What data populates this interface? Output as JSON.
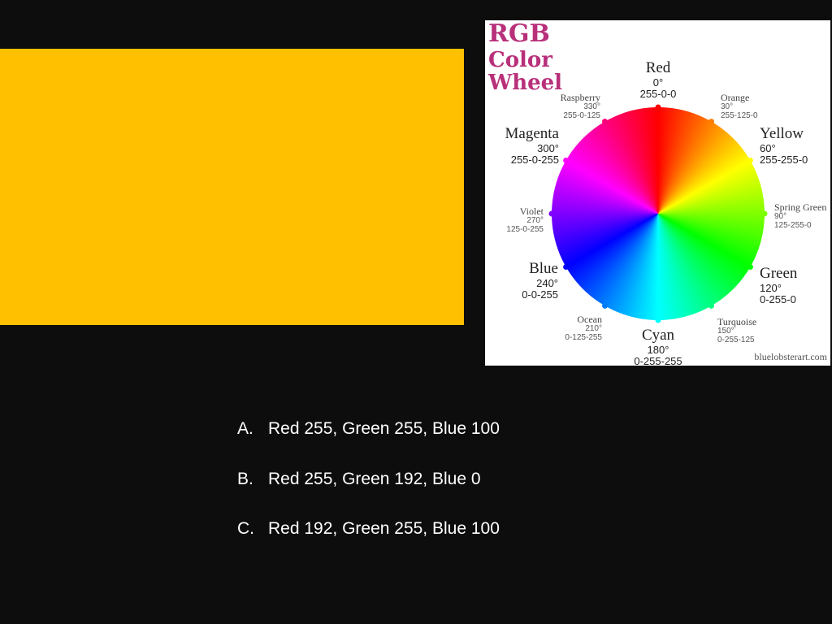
{
  "swatch": {
    "color": "#FFC000"
  },
  "wheel": {
    "title_lines": [
      "RGB",
      "Color",
      "Wheel"
    ],
    "title_color": "#B8307A",
    "credit": "bluelobsterart.com",
    "hues": [
      {
        "name": "Red",
        "deg": "0°",
        "rgb": "255-0-0",
        "size": "major",
        "dot": "#FF0000",
        "angle": 0
      },
      {
        "name": "Orange",
        "deg": "30°",
        "rgb": "255-125-0",
        "size": "minor",
        "dot": "#FF7D00",
        "angle": 30
      },
      {
        "name": "Yellow",
        "deg": "60°",
        "rgb": "255-255-0",
        "size": "major",
        "dot": "#FFFF00",
        "angle": 60
      },
      {
        "name": "Spring Green",
        "deg": "90°",
        "rgb": "125-255-0",
        "size": "minor",
        "dot": "#7DFF00",
        "angle": 90
      },
      {
        "name": "Green",
        "deg": "120°",
        "rgb": "0-255-0",
        "size": "major",
        "dot": "#00FF00",
        "angle": 120
      },
      {
        "name": "Turquoise",
        "deg": "150°",
        "rgb": "0-255-125",
        "size": "minor",
        "dot": "#00FF7D",
        "angle": 150
      },
      {
        "name": "Cyan",
        "deg": "180°",
        "rgb": "0-255-255",
        "size": "major",
        "dot": "#00FFFF",
        "angle": 180
      },
      {
        "name": "Ocean",
        "deg": "210°",
        "rgb": "0-125-255",
        "size": "minor",
        "dot": "#007DFF",
        "angle": 210
      },
      {
        "name": "Blue",
        "deg": "240°",
        "rgb": "0-0-255",
        "size": "major",
        "dot": "#0000FF",
        "angle": 240
      },
      {
        "name": "Violet",
        "deg": "270°",
        "rgb": "125-0-255",
        "size": "minor",
        "dot": "#7D00FF",
        "angle": 270
      },
      {
        "name": "Magenta",
        "deg": "300°",
        "rgb": "255-0-255",
        "size": "major",
        "dot": "#FF00FF",
        "angle": 300
      },
      {
        "name": "Raspberry",
        "deg": "330°",
        "rgb": "255-0-125",
        "size": "minor",
        "dot": "#FF007D",
        "angle": 330
      }
    ]
  },
  "answers": [
    {
      "letter": "A.",
      "text": "Red 255, Green 255, Blue 100"
    },
    {
      "letter": "B.",
      "text": "Red 255, Green 192, Blue 0"
    },
    {
      "letter": "C.",
      "text": "Red 192, Green 255, Blue 100"
    }
  ]
}
